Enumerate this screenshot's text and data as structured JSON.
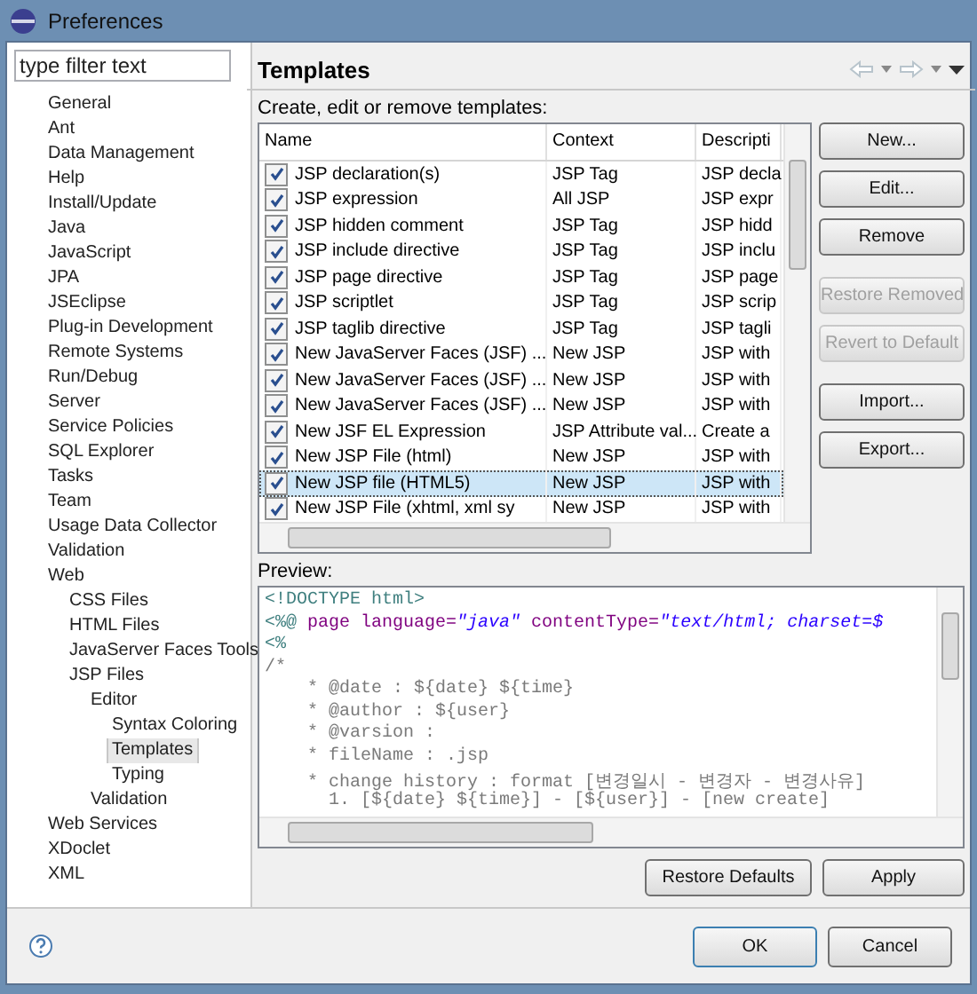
{
  "window": {
    "title": "Preferences"
  },
  "filter": {
    "placeholder": "type filter text"
  },
  "tree": [
    {
      "label": "General",
      "selected": false
    },
    {
      "label": "Ant",
      "selected": false
    },
    {
      "label": "Data Management",
      "selected": false
    },
    {
      "label": "Help",
      "selected": false
    },
    {
      "label": "Install/Update",
      "selected": false
    },
    {
      "label": "Java",
      "selected": false
    },
    {
      "label": "JavaScript",
      "selected": false
    },
    {
      "label": "JPA",
      "selected": false
    },
    {
      "label": "JSEclipse",
      "selected": false
    },
    {
      "label": "Plug-in Development",
      "selected": false
    },
    {
      "label": "Remote Systems",
      "selected": false
    },
    {
      "label": "Run/Debug",
      "selected": false
    },
    {
      "label": "Server",
      "selected": false
    },
    {
      "label": "Service Policies",
      "selected": false
    },
    {
      "label": "SQL Explorer",
      "selected": false
    },
    {
      "label": "Tasks",
      "selected": false
    },
    {
      "label": "Team",
      "selected": false
    },
    {
      "label": "Usage Data Collector",
      "selected": false
    },
    {
      "label": "Validation",
      "selected": false
    },
    {
      "label": "Web",
      "selected": false,
      "children": [
        {
          "label": "CSS Files",
          "selected": false
        },
        {
          "label": "HTML Files",
          "selected": false
        },
        {
          "label": "JavaServer Faces Tools",
          "selected": false
        },
        {
          "label": "JSP Files",
          "selected": false,
          "children": [
            {
              "label": "Editor",
              "selected": false,
              "children": [
                {
                  "label": "Syntax Coloring",
                  "selected": false
                },
                {
                  "label": "Templates",
                  "selected": true
                },
                {
                  "label": "Typing",
                  "selected": false
                }
              ]
            },
            {
              "label": "Validation",
              "selected": false
            }
          ]
        }
      ]
    },
    {
      "label": "Web Services",
      "selected": false
    },
    {
      "label": "XDoclet",
      "selected": false
    },
    {
      "label": "XML",
      "selected": false
    }
  ],
  "page": {
    "title": "Templates",
    "description": "Create, edit or remove templates:"
  },
  "table": {
    "columns": [
      "Name",
      "Context",
      "Descripti"
    ],
    "rows": [
      {
        "checked": true,
        "selected": false,
        "cells": [
          "JSP declaration(s)",
          "JSP Tag",
          "JSP decla"
        ]
      },
      {
        "checked": true,
        "selected": false,
        "cells": [
          "JSP expression",
          "All JSP",
          "JSP expr"
        ]
      },
      {
        "checked": true,
        "selected": false,
        "cells": [
          "JSP hidden comment",
          "JSP Tag",
          "JSP hidd"
        ]
      },
      {
        "checked": true,
        "selected": false,
        "cells": [
          "JSP include directive",
          "JSP Tag",
          "JSP inclu"
        ]
      },
      {
        "checked": true,
        "selected": false,
        "cells": [
          "JSP page directive",
          "JSP Tag",
          "JSP page"
        ]
      },
      {
        "checked": true,
        "selected": false,
        "cells": [
          "JSP scriptlet",
          "JSP Tag",
          "JSP scrip"
        ]
      },
      {
        "checked": true,
        "selected": false,
        "cells": [
          "JSP taglib directive",
          "JSP Tag",
          "JSP tagli"
        ]
      },
      {
        "checked": true,
        "selected": false,
        "cells": [
          "New JavaServer Faces (JSF) ...",
          "New JSP",
          "JSP with"
        ]
      },
      {
        "checked": true,
        "selected": false,
        "cells": [
          "New JavaServer Faces (JSF) ...",
          "New JSP",
          "JSP with"
        ]
      },
      {
        "checked": true,
        "selected": false,
        "cells": [
          "New JavaServer Faces (JSF) ...",
          "New JSP",
          "JSP with"
        ]
      },
      {
        "checked": true,
        "selected": false,
        "cells": [
          "New JSF EL Expression",
          "JSP Attribute val...",
          "Create a"
        ]
      },
      {
        "checked": true,
        "selected": false,
        "cells": [
          "New JSP File (html)",
          "New JSP",
          "JSP with"
        ]
      },
      {
        "checked": true,
        "selected": true,
        "cells": [
          "New JSP file (HTML5)",
          "New JSP",
          "JSP with"
        ]
      },
      {
        "checked": true,
        "selected": false,
        "cells": [
          "New JSP File (xhtml, xml sy",
          "New JSP",
          "JSP with"
        ]
      }
    ]
  },
  "side_buttons": [
    {
      "label": "New...",
      "disabled": false
    },
    {
      "label": "Edit...",
      "disabled": false
    },
    {
      "label": "Remove",
      "disabled": false
    },
    {
      "label": "Restore Removed",
      "disabled": true
    },
    {
      "label": "Revert to Default",
      "disabled": true
    },
    {
      "label": "Import...",
      "disabled": false
    },
    {
      "label": "Export...",
      "disabled": false
    }
  ],
  "preview": {
    "label": "Preview:",
    "lines": [
      [
        {
          "kind": "markup",
          "text": "<!DOCTYPE html>"
        }
      ],
      [
        {
          "kind": "markup",
          "text": "<%@ "
        },
        {
          "kind": "attr",
          "text": "page language="
        },
        {
          "kind": "string",
          "text": "\"java\""
        },
        {
          "kind": "attr",
          "text": " contentType="
        },
        {
          "kind": "string",
          "text": "\"text/html; charset=$"
        }
      ],
      [
        {
          "kind": "markup",
          "text": "<%"
        }
      ],
      [
        {
          "kind": "comment",
          "text": "/*"
        }
      ],
      [
        {
          "kind": "comment",
          "text": "    * @date : ${date} ${time}"
        }
      ],
      [
        {
          "kind": "comment",
          "text": "    * @author : ${user}"
        }
      ],
      [
        {
          "kind": "comment",
          "text": "    * @varsion :"
        }
      ],
      [
        {
          "kind": "comment",
          "text": "    * fileName : .jsp"
        }
      ],
      [
        {
          "kind": "comment",
          "text": "    * change history : format [변경일시 - 변경자 - 변경사유]"
        }
      ],
      [
        {
          "kind": "comment",
          "text": "      1. [${date} ${time}] - [${user}] - [new create]"
        }
      ]
    ]
  },
  "page_buttons": [
    "Restore Defaults",
    "Apply"
  ],
  "dialog_buttons": [
    {
      "label": "OK",
      "default": true
    },
    {
      "label": "Cancel",
      "default": false
    }
  ]
}
